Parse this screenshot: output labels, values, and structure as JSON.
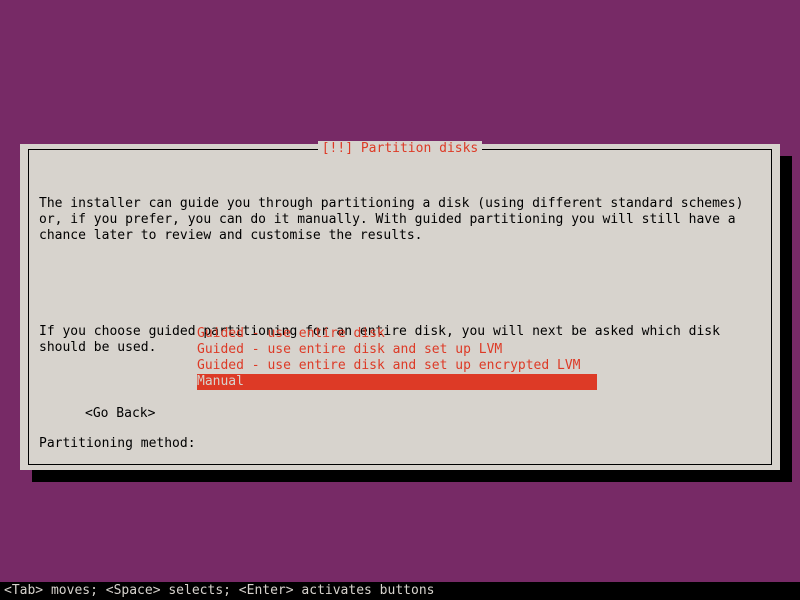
{
  "dialog": {
    "title": "[!!] Partition disks",
    "body_para1": "The installer can guide you through partitioning a disk (using different standard schemes) or, if you prefer, you can do it manually. With guided partitioning you will still have a chance later to review and customise the results.",
    "body_para2": "If you choose guided partitioning for an entire disk, you will next be asked which disk should be used.",
    "method_label": "Partitioning method:",
    "options": [
      "Guided - use entire disk",
      "Guided - use entire disk and set up LVM",
      "Guided - use entire disk and set up encrypted LVM",
      "Manual"
    ],
    "selected_index": 3,
    "go_back": "<Go Back>"
  },
  "footer": "<Tab> moves; <Space> selects; <Enter> activates buttons"
}
